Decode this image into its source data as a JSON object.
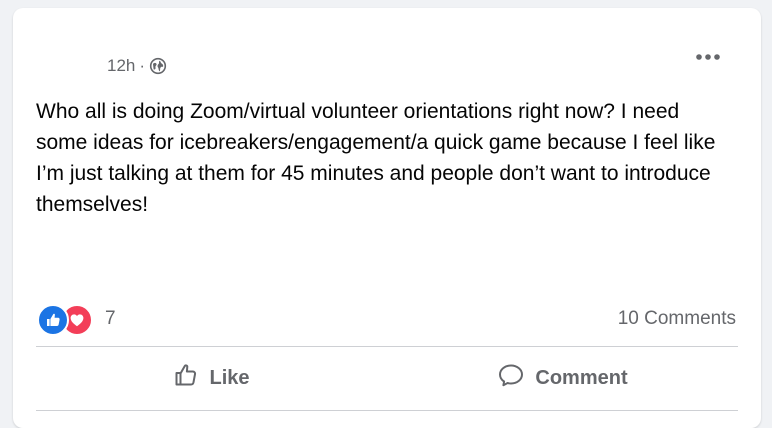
{
  "post": {
    "timestamp": "12h",
    "separator": "·",
    "audience_icon": "globe-icon",
    "more_icon": "more-options-icon",
    "text": "Who all is doing Zoom/virtual volunteer orientations right now? I need some ideas for icebreakers/engagement/a quick game because I feel like I’m just talking at them for 45 minutes and people don’t want to introduce themselves!"
  },
  "reactions": {
    "icons": [
      "like-reaction-icon",
      "love-reaction-icon"
    ],
    "count": "7",
    "like_color": "#1b74e4",
    "love_color": "#f33e58"
  },
  "comments": {
    "count_label": "10 Comments"
  },
  "actions": {
    "like_label": "Like",
    "like_icon": "thumbs-up-icon",
    "comment_label": "Comment",
    "comment_icon": "comment-bubble-icon"
  }
}
